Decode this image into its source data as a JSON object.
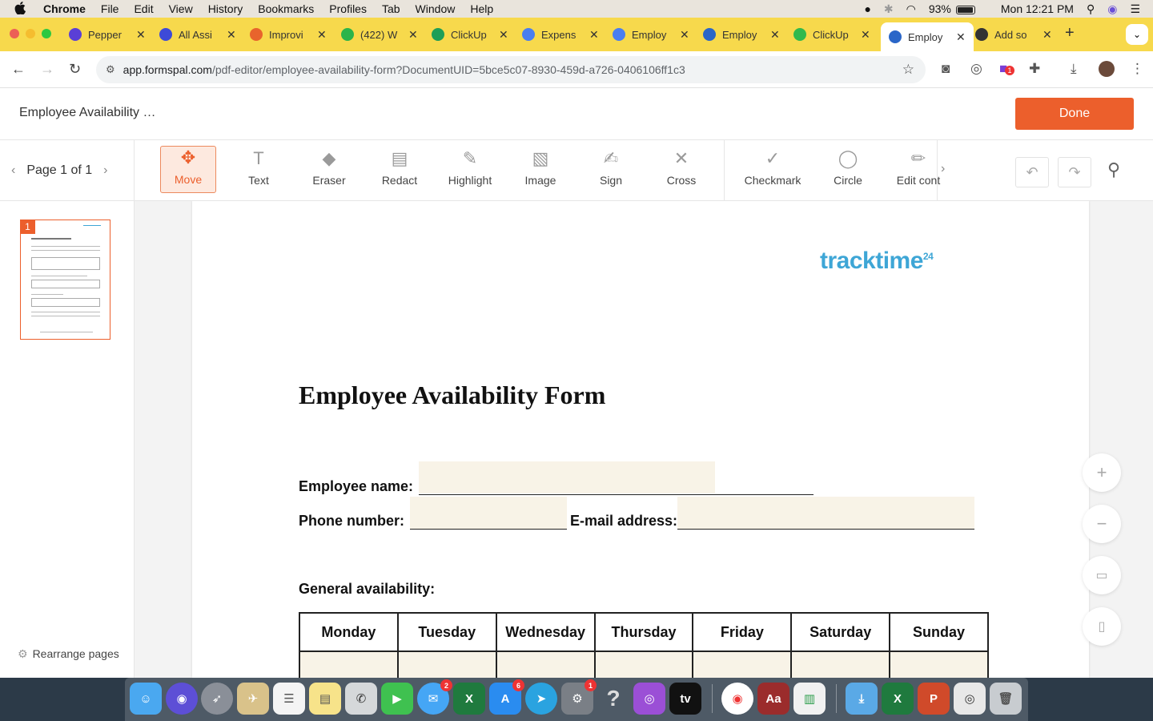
{
  "menubar": {
    "items": [
      "Chrome",
      "File",
      "Edit",
      "View",
      "History",
      "Bookmarks",
      "Profiles",
      "Tab",
      "Window",
      "Help"
    ],
    "battery": "93%",
    "clock": "Mon 12:21 PM"
  },
  "tabs": [
    {
      "label": "Pepper",
      "icon": "pepper-icon",
      "color": "#5a3fd6"
    },
    {
      "label": "All Assi",
      "icon": "assistant-icon",
      "color": "#3d4ad8"
    },
    {
      "label": "Improvi",
      "icon": "spark-icon",
      "color": "#e8642c"
    },
    {
      "label": "(422) W",
      "icon": "whatsapp-icon",
      "color": "#2bb44a"
    },
    {
      "label": "ClickUp",
      "icon": "clickup-icon",
      "color": "#1e9e57"
    },
    {
      "label": "Expens",
      "icon": "docs-icon",
      "color": "#4a7ef0"
    },
    {
      "label": "Employ",
      "icon": "docs-icon",
      "color": "#4a7ef0"
    },
    {
      "label": "Employ",
      "icon": "formspal-icon",
      "color": "#2a66c8"
    },
    {
      "label": "ClickUp",
      "icon": "checkmark-icon",
      "color": "#31b94d"
    },
    {
      "label": "Employ",
      "icon": "formspal-icon",
      "color": "#2a66c8"
    },
    {
      "label": "Add so",
      "icon": "bot-icon",
      "color": "#333333"
    }
  ],
  "address": {
    "host": "app.formspal.com",
    "path": "/pdf-editor/employee-availability-form?DocumentUID=5bce5c07-8930-459d-a726-0406106ff1c3"
  },
  "extensions": {
    "badge": "1"
  },
  "app": {
    "doc_title": "Employee Availability …",
    "done_label": "Done",
    "accent": "#ec5f2c"
  },
  "pagenav": {
    "label": "Page 1 of 1"
  },
  "tools": [
    {
      "label": "Move",
      "icon": "move-icon",
      "glyph": "✥"
    },
    {
      "label": "Text",
      "icon": "text-icon",
      "glyph": "T"
    },
    {
      "label": "Eraser",
      "icon": "eraser-icon",
      "glyph": "◆"
    },
    {
      "label": "Redact",
      "icon": "redact-icon",
      "glyph": "▤"
    },
    {
      "label": "Highlight",
      "icon": "highlight-icon",
      "glyph": "✎"
    },
    {
      "label": "Image",
      "icon": "image-icon",
      "glyph": "▧"
    },
    {
      "label": "Sign",
      "icon": "sign-icon",
      "glyph": "✍"
    },
    {
      "label": "Cross",
      "icon": "cross-icon",
      "glyph": "✕"
    },
    {
      "label": "Checkmark",
      "icon": "checkmark-icon",
      "glyph": "✓"
    },
    {
      "label": "Circle",
      "icon": "circle-icon",
      "glyph": "◯"
    },
    {
      "label": "Edit cont",
      "icon": "pencil-icon",
      "glyph": "✏"
    }
  ],
  "sidebar": {
    "page_number": "1",
    "rearrange_label": "Rearrange pages"
  },
  "document": {
    "logo_text": "tracktime",
    "logo_sup": "24",
    "title": "Employee Availability Form",
    "employee_name_label": "Employee name:",
    "phone_label": "Phone number:",
    "email_label": "E-mail address:",
    "general_label": "General availability:",
    "days": [
      "Monday",
      "Tuesday",
      "Wednesday",
      "Thursday",
      "Friday",
      "Saturday",
      "Sunday"
    ]
  },
  "dock": {
    "badges": {
      "messages": "2",
      "appstore": "6",
      "settings": "1"
    }
  }
}
